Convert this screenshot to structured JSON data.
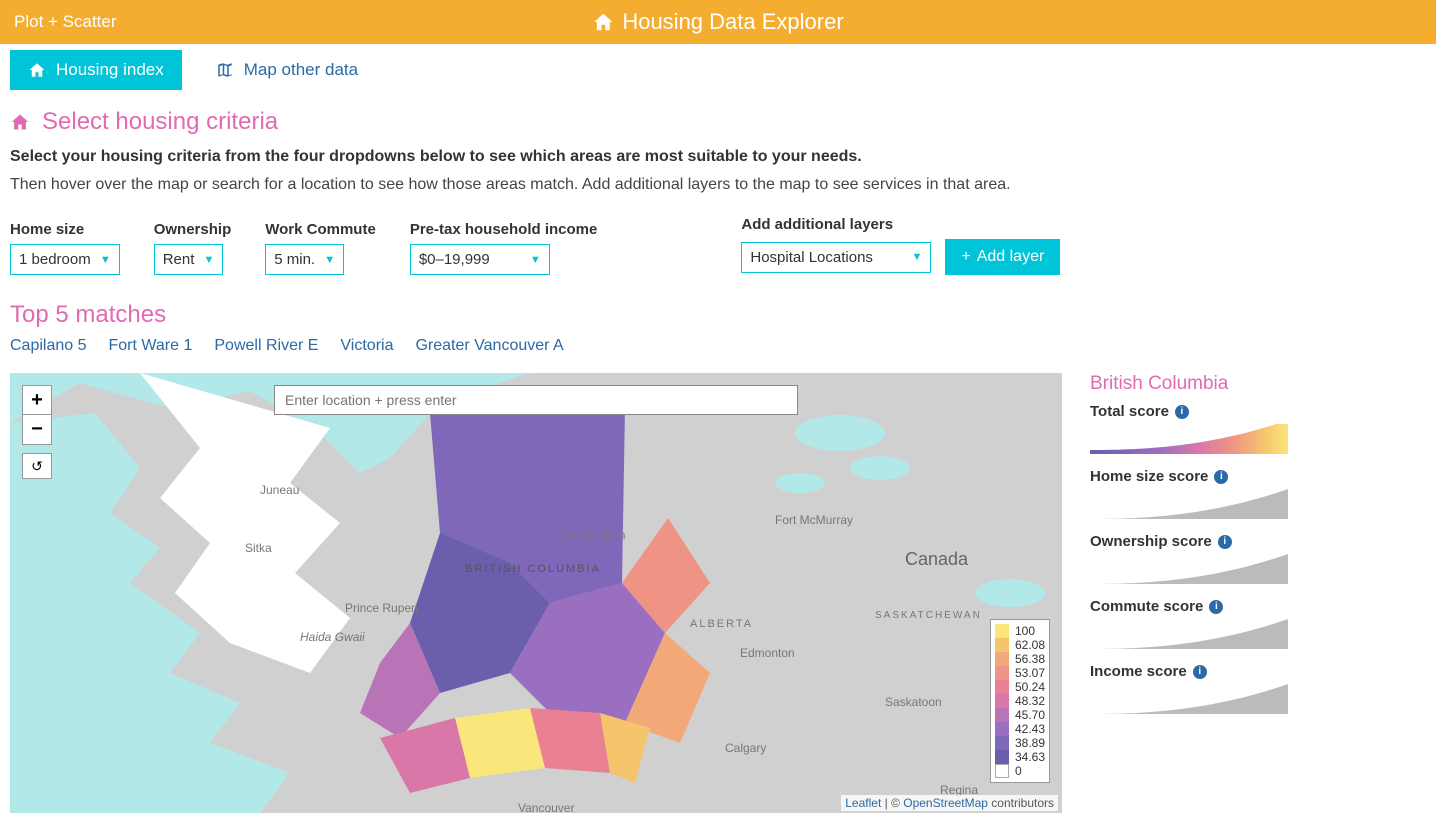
{
  "header": {
    "brand": "Plot + Scatter",
    "title": "Housing Data Explorer"
  },
  "tabs": {
    "active": "Housing index",
    "secondary": "Map other data"
  },
  "criteria": {
    "title": "Select housing criteria",
    "instr1": "Select your housing criteria from the four dropdowns below to see which areas are most suitable to your needs.",
    "instr2": "Then hover over the map or search for a location to see how those areas match. Add additional layers to the map to see services in that area.",
    "home_size": {
      "label": "Home size",
      "value": "1 bedroom"
    },
    "ownership": {
      "label": "Ownership",
      "value": "Rent"
    },
    "commute": {
      "label": "Work Commute",
      "value": "5 min."
    },
    "income": {
      "label": "Pre-tax household income",
      "value": "$0–19,999"
    },
    "layers": {
      "label": "Add additional layers",
      "value": "Hospital Locations",
      "btn": "Add layer"
    }
  },
  "matches": {
    "title": "Top 5 matches",
    "items": [
      "Capilano 5",
      "Fort Ware 1",
      "Powell River E",
      "Victoria",
      "Greater Vancouver A"
    ]
  },
  "map": {
    "search_placeholder": "Enter location + press enter",
    "attrib_leaflet": "Leaflet",
    "attrib_osm": "OpenStreetMap",
    "attrib_tail": " contributors",
    "labels": {
      "juneau": "Juneau",
      "sitka": "Sitka",
      "hg": "Haida Gwaii",
      "bc": "BRITISH COLUMBIA",
      "pr": "Prince Rupert",
      "fsj": "Fort St John",
      "fm": "Fort McMurray",
      "canada": "Canada",
      "alberta": "ALBERTA",
      "sask": "SASKATCHEWAN",
      "edm": "Edmonton",
      "sktn": "Saskatoon",
      "cgy": "Calgary",
      "reg": "Regina",
      "van": "Vancouver"
    },
    "legend": [
      {
        "c": "#fae67a",
        "v": "100"
      },
      {
        "c": "#f5c56e",
        "v": "62.08"
      },
      {
        "c": "#f2a878",
        "v": "56.38"
      },
      {
        "c": "#ef9485",
        "v": "53.07"
      },
      {
        "c": "#ea8193",
        "v": "50.24"
      },
      {
        "c": "#d977a8",
        "v": "48.32"
      },
      {
        "c": "#b974b8",
        "v": "45.70"
      },
      {
        "c": "#9a6fc0",
        "v": "42.43"
      },
      {
        "c": "#7f68ba",
        "v": "38.89"
      },
      {
        "c": "#6a5ead",
        "v": "34.63"
      },
      {
        "c": "#ffffff",
        "v": "0"
      }
    ]
  },
  "side": {
    "region": "British Columbia",
    "scores": [
      {
        "label": "Total score",
        "grad": true
      },
      {
        "label": "Home size score",
        "grad": false
      },
      {
        "label": "Ownership score",
        "grad": false
      },
      {
        "label": "Commute score",
        "grad": false
      },
      {
        "label": "Income score",
        "grad": false
      }
    ]
  }
}
